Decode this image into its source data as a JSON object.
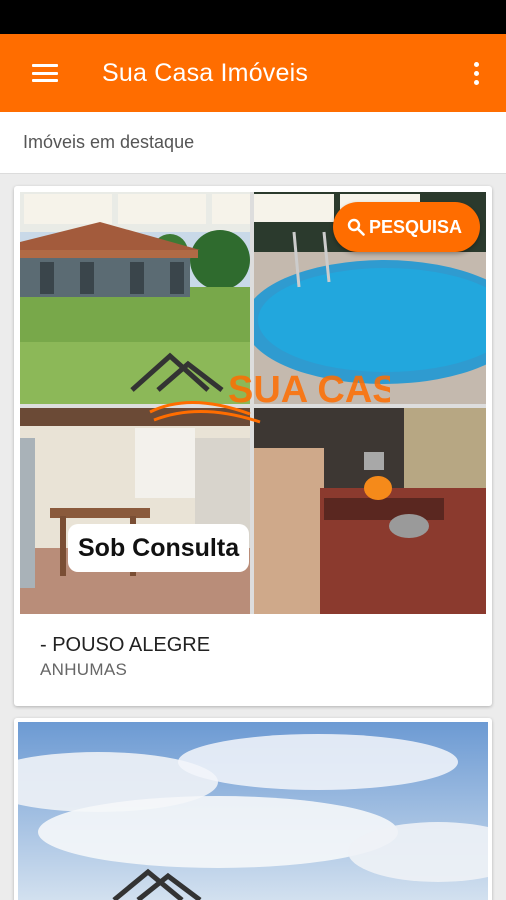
{
  "app_bar": {
    "title": "Sua Casa Imóveis",
    "menu_icon": "hamburger-menu-icon",
    "overflow_icon": "more-vertical-icon",
    "color": "#ff6d00"
  },
  "section": {
    "title": "Imóveis em destaque"
  },
  "search_button": {
    "label": "PESQUISA",
    "icon": "search-icon"
  },
  "listings": [
    {
      "price": "Sob Consulta",
      "title": "- POUSO ALEGRE",
      "subtitle": "ANHUMAS",
      "watermark": "SUA CASA"
    }
  ]
}
